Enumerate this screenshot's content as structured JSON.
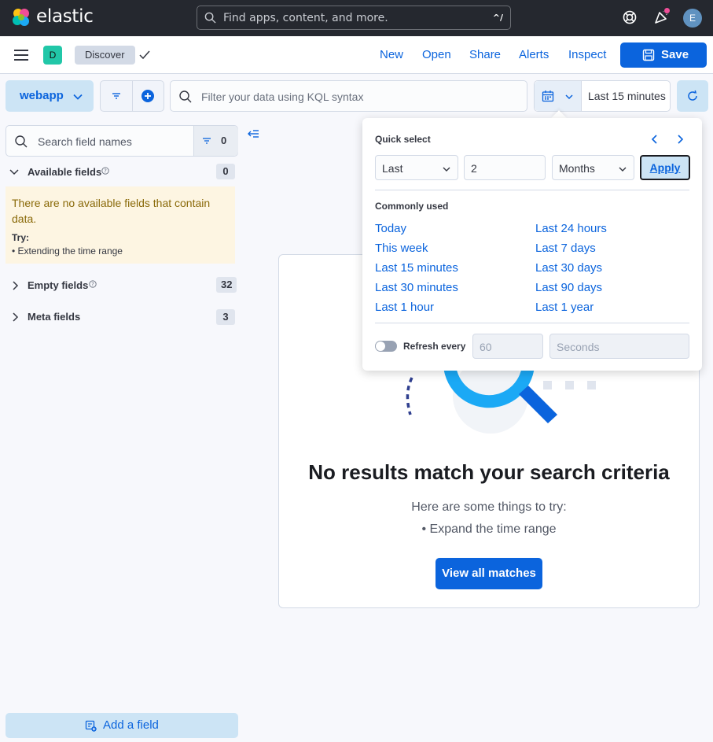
{
  "header": {
    "brand": "elastic",
    "search_placeholder": "Find apps, content, and more.",
    "search_shortcut": "^/",
    "user_initial": "E",
    "colors": {
      "bar": "#25282f",
      "accent": "#0b64dd",
      "badge": "#f04e98"
    }
  },
  "appbar": {
    "space_initial": "D",
    "breadcrumb": "Discover",
    "links": [
      "New",
      "Open",
      "Share",
      "Alerts",
      "Inspect"
    ],
    "save_label": "Save"
  },
  "querybar": {
    "data_view": "webapp",
    "kql_placeholder": "Filter your data using KQL syntax",
    "time_range": "Last 15 minutes"
  },
  "sidebar": {
    "search_placeholder": "Search field names",
    "filter_count": "0",
    "available_fields": {
      "label": "Available fields",
      "count": "0"
    },
    "callout": {
      "title": "There are no available fields that contain data.",
      "try_label": "Try:",
      "item": "Extending the time range"
    },
    "empty_fields": {
      "label": "Empty fields",
      "count": "32"
    },
    "meta_fields": {
      "label": "Meta fields",
      "count": "3"
    },
    "add_field_label": "Add a field"
  },
  "main": {
    "empty_title": "No results match your search criteria",
    "empty_subtitle": "Here are some things to try:",
    "empty_item": "Expand the time range",
    "view_all_label": "View all matches"
  },
  "popover": {
    "quick_select_label": "Quick select",
    "tense_value": "Last",
    "quantity_value": "2",
    "unit_value": "Months",
    "apply_label": "Apply",
    "commonly_used_label": "Commonly used",
    "commonly_used_left": [
      "Today",
      "This week",
      "Last 15 minutes",
      "Last 30 minutes",
      "Last 1 hour"
    ],
    "commonly_used_right": [
      "Last 24 hours",
      "Last 7 days",
      "Last 30 days",
      "Last 90 days",
      "Last 1 year"
    ],
    "refresh_label": "Refresh every",
    "refresh_value": "60",
    "refresh_unit": "Seconds"
  }
}
